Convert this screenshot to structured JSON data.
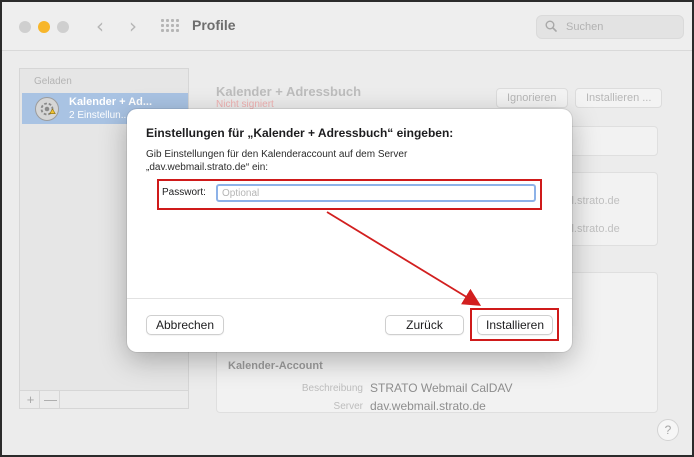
{
  "window": {
    "title": "Profile",
    "search_placeholder": "Suchen"
  },
  "sidebar": {
    "header": "Geladen",
    "items": [
      {
        "title": "Kalender + Ad...",
        "subtitle": "2 Einstellun..."
      }
    ],
    "add_symbol": "+",
    "remove_symbol": "—"
  },
  "main": {
    "profile_title": "Kalender + Adressbuch",
    "status": "Nicht signiert",
    "ignore_button": "Ignorieren",
    "install_button": "Installieren ...",
    "server_text_1": "il.strato.de",
    "server_text_2": "il.strato.de",
    "calendar_section": {
      "heading": "Kalender-Account",
      "fields": [
        {
          "label": "Beschreibung",
          "value": "STRATO Webmail CalDAV"
        },
        {
          "label": "Server",
          "value": "dav.webmail.strato.de"
        }
      ]
    },
    "help_label": "?"
  },
  "dialog": {
    "title": "Einstellungen für „Kalender + Adressbuch“ eingeben:",
    "description": "Gib Einstellungen für den Kalenderaccount auf dem Server „dav.webmail.strato.de“ ein:",
    "password_label": "Passwort:",
    "password_value": "",
    "password_placeholder": "Optional",
    "cancel_button": "Abbrechen",
    "back_button": "Zurück",
    "install_button": "Installieren"
  },
  "colors": {
    "highlight": "#cf1a1a",
    "traffic_yellow": "#f7b62b",
    "selection": "#a9c3e3"
  }
}
